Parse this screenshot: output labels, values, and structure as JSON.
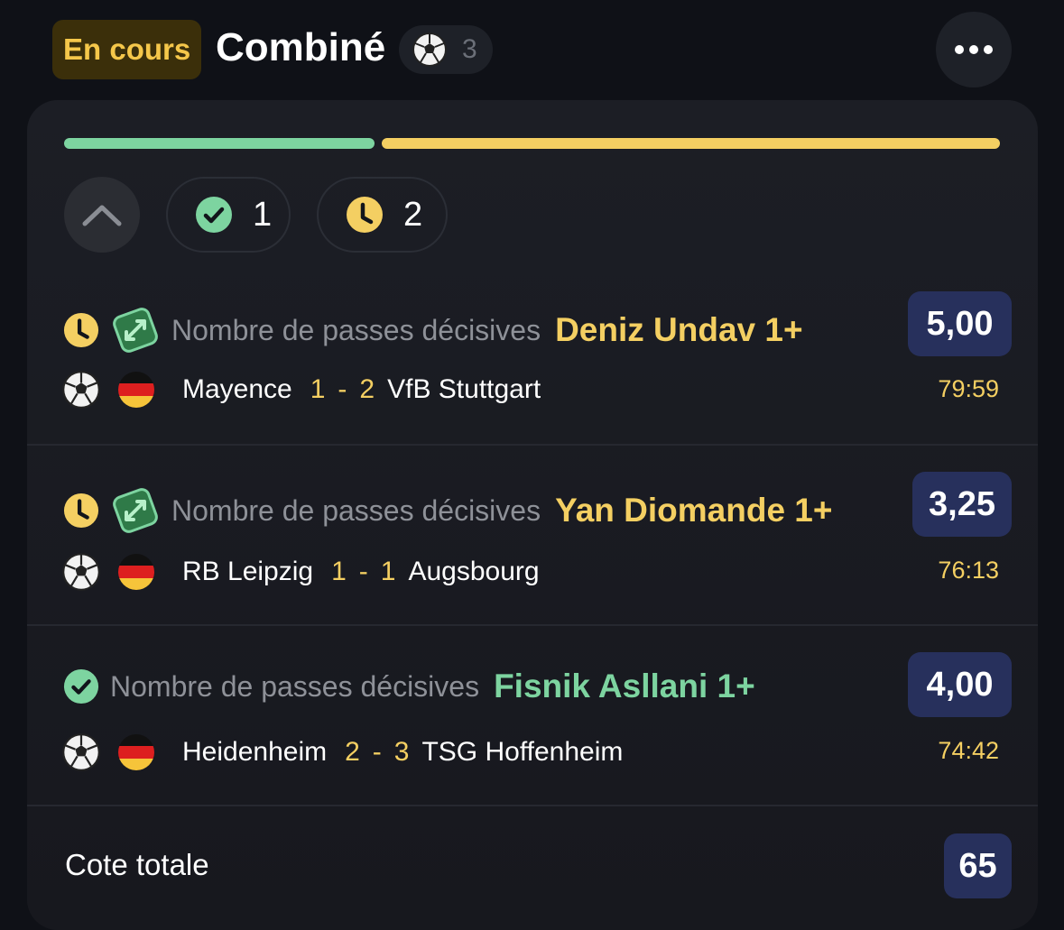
{
  "header": {
    "status": "En cours",
    "title": "Combiné",
    "sport_icon": "soccer-ball-icon",
    "count": "3",
    "more_icon": "ellipsis-icon"
  },
  "progress": {
    "won_fraction": 0.333,
    "pending_fraction": 0.667,
    "won_color": "#7dd4a0",
    "pending_color": "#f4cf62"
  },
  "filters": {
    "won_count": "1",
    "pending_count": "2"
  },
  "selections": [
    {
      "status": "pending",
      "market": "Nombre de passes décisives",
      "name": "Deniz Undav 1+",
      "odds": "5,00",
      "home": "Mayence",
      "home_score": "1",
      "away_score": "2",
      "away": "VfB Stuttgart",
      "clock": "79:59"
    },
    {
      "status": "pending",
      "market": "Nombre de passes décisives",
      "name": "Yan Diomande 1+",
      "odds": "3,25",
      "home": "RB Leipzig",
      "home_score": "1",
      "away_score": "1",
      "away": "Augsbourg",
      "clock": "76:13"
    },
    {
      "status": "won",
      "market": "Nombre de passes décisives",
      "name": "Fisnik Asllani 1+",
      "odds": "4,00",
      "home": "Heidenheim",
      "home_score": "2",
      "away_score": "3",
      "away": "TSG Hoffenheim",
      "clock": "74:42"
    }
  ],
  "total": {
    "label": "Cote totale",
    "value": "65"
  }
}
